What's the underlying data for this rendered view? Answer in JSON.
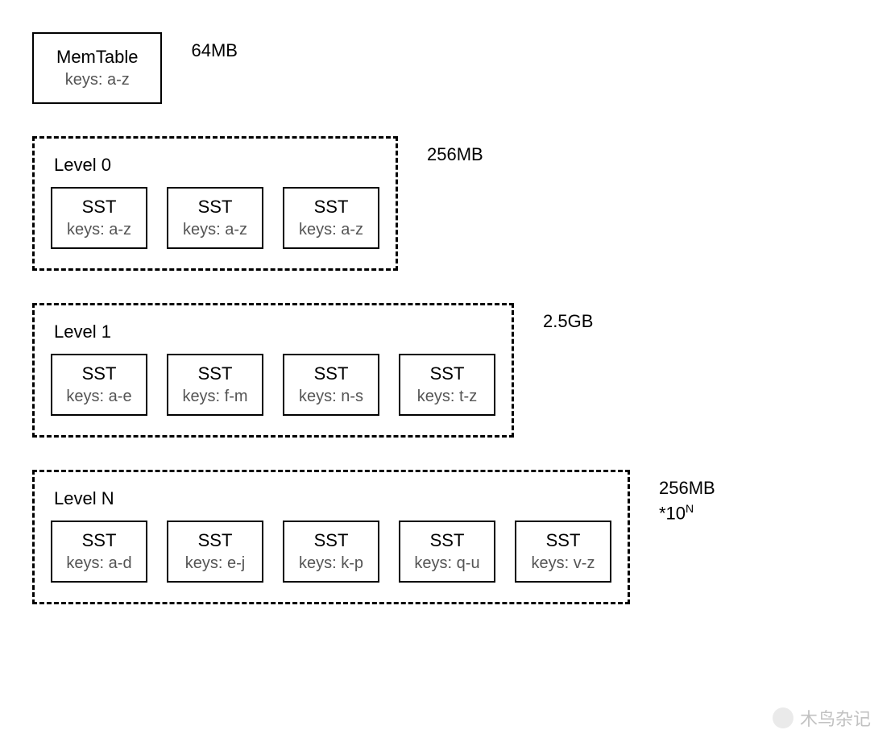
{
  "memtable": {
    "title": "MemTable",
    "keys": "keys: a-z",
    "size": "64MB"
  },
  "levels": [
    {
      "label": "Level 0",
      "size": "256MB",
      "ssts": [
        {
          "title": "SST",
          "keys": "keys: a-z"
        },
        {
          "title": "SST",
          "keys": "keys: a-z"
        },
        {
          "title": "SST",
          "keys": "keys: a-z"
        }
      ]
    },
    {
      "label": "Level 1",
      "size": "2.5GB",
      "ssts": [
        {
          "title": "SST",
          "keys": "keys: a-e"
        },
        {
          "title": "SST",
          "keys": "keys: f-m"
        },
        {
          "title": "SST",
          "keys": "keys: n-s"
        },
        {
          "title": "SST",
          "keys": "keys: t-z"
        }
      ]
    },
    {
      "label": "Level N",
      "size_base": "256MB",
      "size_mult": "*10",
      "size_exp": "N",
      "ssts": [
        {
          "title": "SST",
          "keys": "keys: a-d"
        },
        {
          "title": "SST",
          "keys": "keys: e-j"
        },
        {
          "title": "SST",
          "keys": "keys: k-p"
        },
        {
          "title": "SST",
          "keys": "keys: q-u"
        },
        {
          "title": "SST",
          "keys": "keys: v-z"
        }
      ]
    }
  ],
  "watermark": "木鸟杂记"
}
